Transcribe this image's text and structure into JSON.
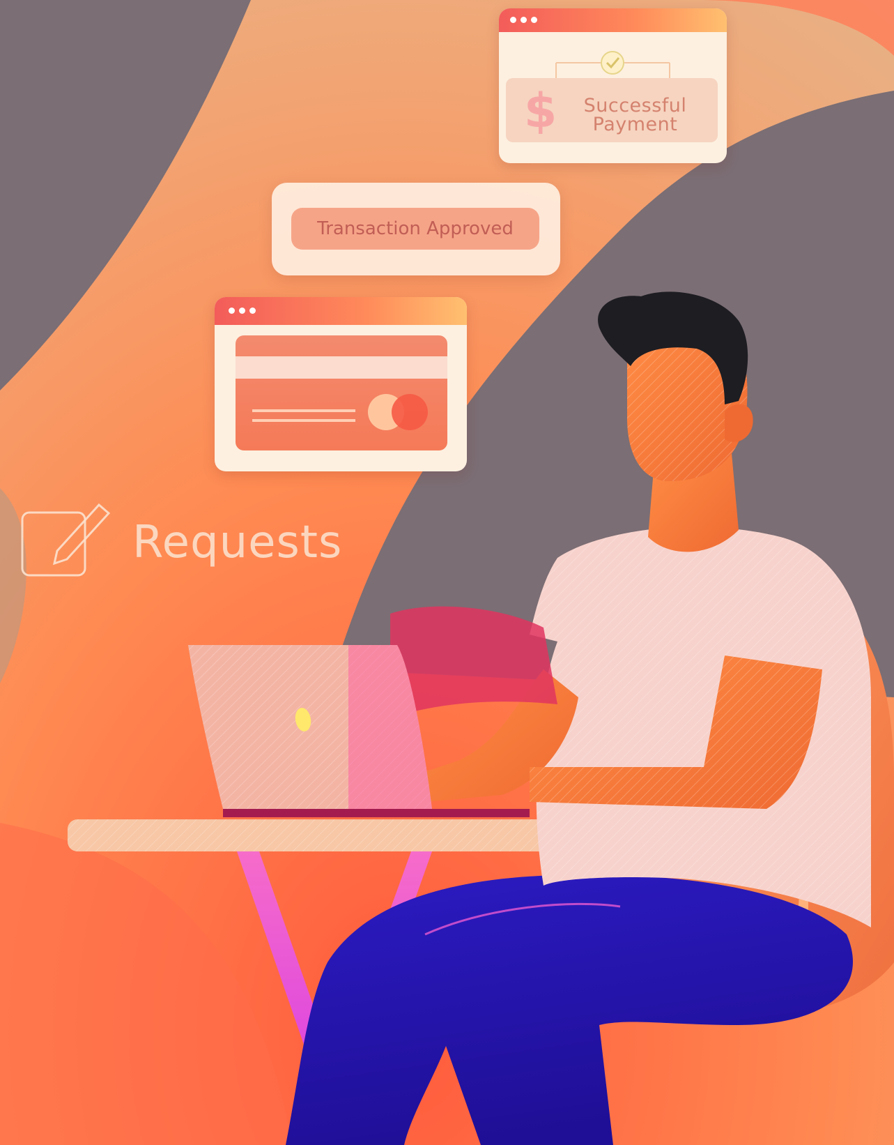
{
  "cards": {
    "payment": {
      "line1": "Successful",
      "line2": "Payment",
      "icon": "dollar-icon",
      "status_icon": "check-circle-icon"
    },
    "transaction": {
      "label": "Transaction Approved"
    },
    "credit_card_window": {
      "icon": "credit-card-icon"
    }
  },
  "requests": {
    "label": "Requests",
    "icon": "edit-icon"
  },
  "colors": {
    "accent_coral": "#f35c5a",
    "accent_orange": "#ff8a5a",
    "accent_yellow": "#ffc070",
    "background_gray": "#7a6f76",
    "pants_blue": "#2a18b8",
    "pink": "#e83f87"
  }
}
